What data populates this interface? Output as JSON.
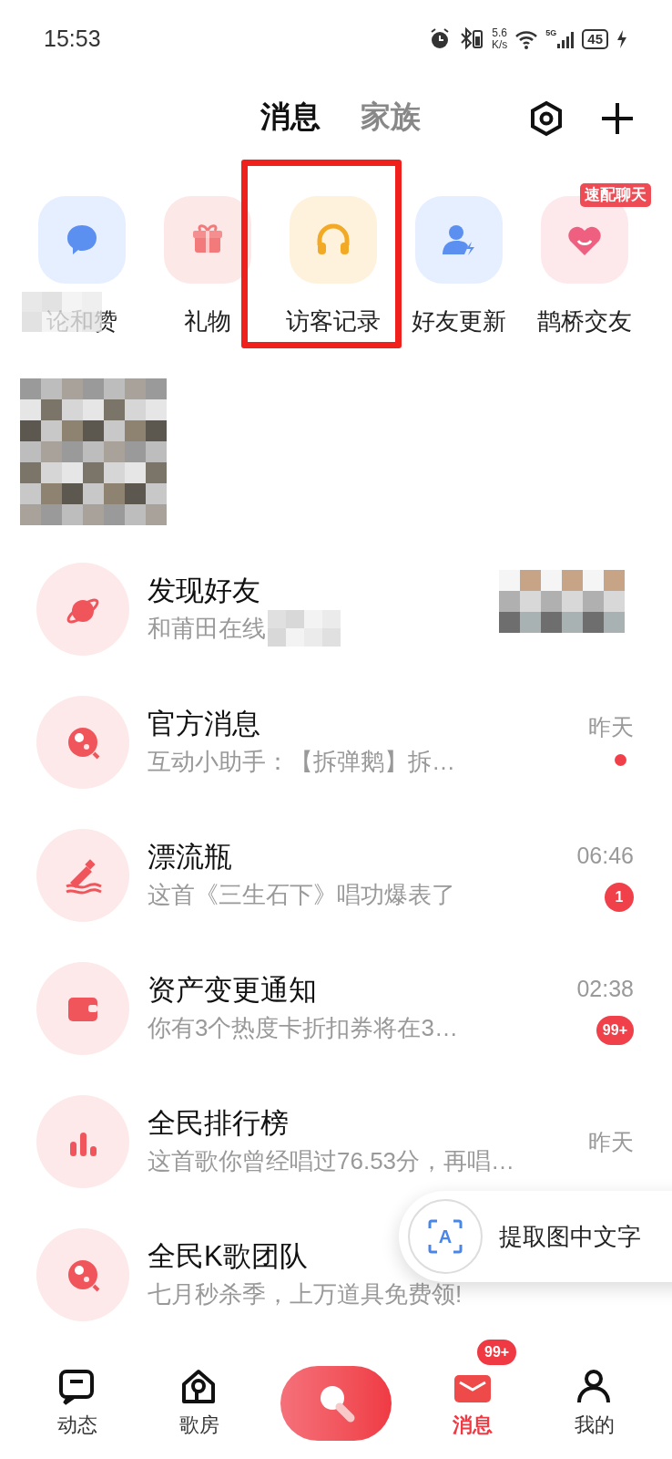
{
  "status_bar": {
    "time": "15:53",
    "speed_value": "5.6",
    "speed_unit": "K/s",
    "network": "5G",
    "battery": "45"
  },
  "tabs": [
    {
      "label": "消息",
      "selected": true
    },
    {
      "label": "家族",
      "selected": false
    }
  ],
  "shortcuts": [
    {
      "label": "论和赞",
      "highlighted": false
    },
    {
      "label": "礼物",
      "highlighted": false
    },
    {
      "label": "访客记录",
      "highlighted": true
    },
    {
      "label": "好友更新",
      "highlighted": false
    },
    {
      "label": "鹊桥交友",
      "highlighted": false,
      "tag": "速配聊天"
    }
  ],
  "conversations": [
    {
      "title": "发现好友",
      "preview": "和莆田在线"
    },
    {
      "title": "官方消息",
      "preview": "互动小助手：【拆弹鹅】拆…",
      "time": "昨天",
      "badge": {
        "kind": "dot"
      }
    },
    {
      "title": "漂流瓶",
      "preview": "这首《三生石下》唱功爆表了",
      "time": "06:46",
      "badge": {
        "kind": "count",
        "text": "1"
      }
    },
    {
      "title": "资产变更通知",
      "preview": "你有3个热度卡折扣券将在3…",
      "time": "02:38",
      "badge": {
        "kind": "count",
        "text": "99+"
      }
    },
    {
      "title": "全民排行榜",
      "preview": "这首歌你曾经唱过76.53分，再唱…",
      "time": "昨天"
    },
    {
      "title": "全民K歌团队",
      "preview": "七月秒杀季，上万道具免费领!"
    }
  ],
  "ocr_button": {
    "glyph": "A",
    "label": "提取图中文字"
  },
  "nav": [
    {
      "kind": "tab",
      "label": "动态",
      "selected": false
    },
    {
      "kind": "tab",
      "label": "歌房",
      "selected": false
    },
    {
      "kind": "center"
    },
    {
      "kind": "tab",
      "label": "消息",
      "selected": true,
      "badge": "99+"
    },
    {
      "kind": "tab",
      "label": "我的",
      "selected": false
    }
  ]
}
